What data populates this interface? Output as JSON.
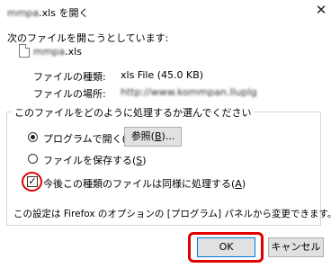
{
  "window": {
    "title_blurred": "mmpa",
    "title_suffix": ".xls を開く",
    "close_glyph": "✕"
  },
  "intro": "次のファイルを開こうとしています:",
  "file": {
    "name_blurred": "mmpa",
    "name_suffix": ".xls",
    "type_label": "ファイルの種類:",
    "type_value": "xls File (45.0 KB)",
    "location_label": "ファイルの場所:",
    "location_value": "http://www.kommpan.lluplg"
  },
  "group": {
    "legend": "このファイルをどのように処理するか選んでください",
    "open_with": {
      "label": "プログラムで開く(",
      "key": "O",
      "label_end": "):",
      "selected": true
    },
    "browse_button": {
      "label": "参照(",
      "key": "B",
      "label_end": ")..."
    },
    "save_file": {
      "label": "ファイルを保存する(",
      "key": "S",
      "label_end": ")",
      "selected": false
    },
    "remember": {
      "label": "今後この種類のファイルは同様に処理する(",
      "key": "A",
      "label_end": ")",
      "checked": true,
      "check_glyph": "✓"
    },
    "info": "この設定は Firefox のオプションの [プログラム] パネルから変更できます。"
  },
  "buttons": {
    "ok": "OK",
    "cancel": "キャンセル"
  },
  "colors": {
    "highlight": "#e00000",
    "button_bg": "#e1e1e1",
    "ok_border": "#0078d7"
  }
}
